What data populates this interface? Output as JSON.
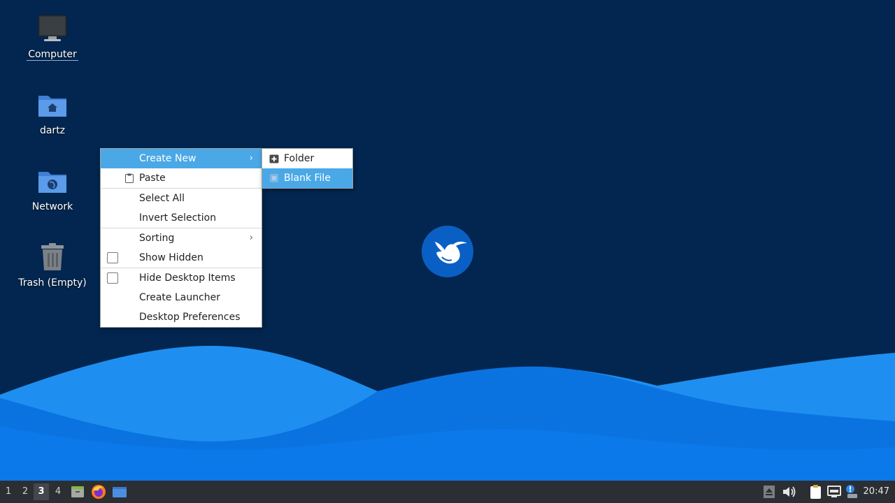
{
  "desktop": {
    "icons": [
      {
        "label": "Computer",
        "icon": "computer-icon"
      },
      {
        "label": "dartz",
        "icon": "home-folder-icon"
      },
      {
        "label": "Network",
        "icon": "network-folder-icon"
      },
      {
        "label": "Trash (Empty)",
        "icon": "trash-icon"
      }
    ],
    "colors": {
      "background": "#02264f",
      "wave_light": "#1e8ff0",
      "wave_mid": "#0a73e0",
      "wave_dark": "#085fc9"
    },
    "logo": "hummingbird-logo-icon"
  },
  "context_menu": {
    "items": [
      {
        "label": "Create New",
        "has_submenu": true,
        "highlighted": true
      },
      {
        "label": "Paste",
        "icon": "clipboard-icon"
      },
      {
        "label": "Select All"
      },
      {
        "label": "Invert Selection"
      },
      {
        "label": "Sorting",
        "has_submenu": true
      },
      {
        "label": "Show Hidden",
        "checkbox": true,
        "checked": false
      },
      {
        "label": "Hide Desktop Items",
        "checkbox": true,
        "checked": false
      },
      {
        "label": "Create Launcher"
      },
      {
        "label": "Desktop Preferences"
      }
    ],
    "arrow": "›",
    "highlight_color": "#4aa8e6"
  },
  "submenu": {
    "items": [
      {
        "label": "Folder",
        "icon": "folder-add-icon"
      },
      {
        "label": "Blank File",
        "icon": "blank-file-icon",
        "highlighted": true
      }
    ]
  },
  "taskbar": {
    "workspaces": [
      "1",
      "2",
      "3",
      "4"
    ],
    "active_workspace": "3",
    "launchers": [
      "file-manager-icon",
      "firefox-icon",
      "show-desktop-icon"
    ],
    "tray": [
      "eject-icon",
      "volume-icon",
      "clipboard-tray-icon",
      "network-tray-icon",
      "update-notifier-icon"
    ],
    "clock": "20:47"
  }
}
